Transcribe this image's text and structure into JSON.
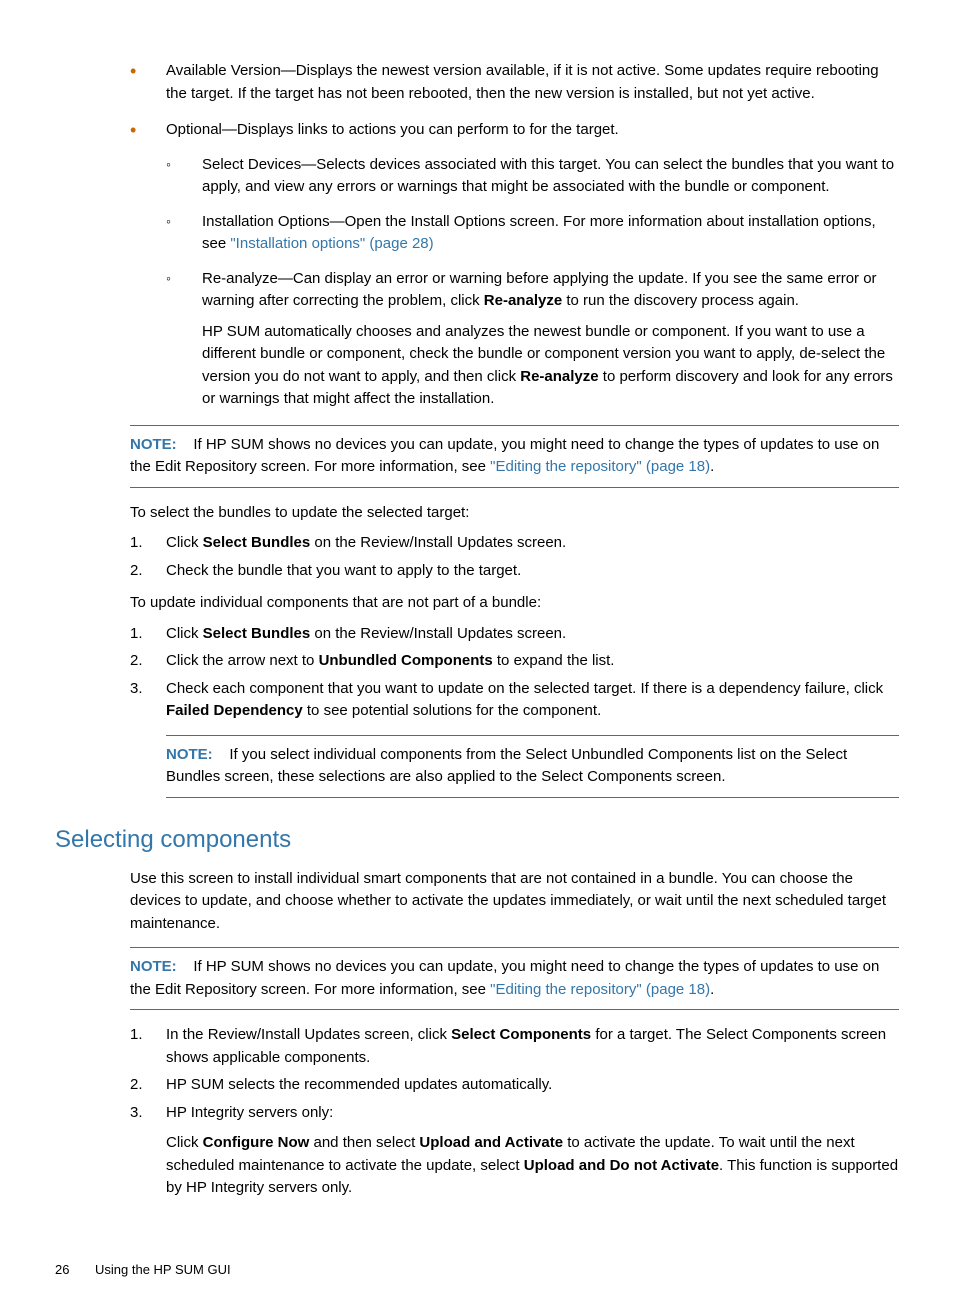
{
  "bullets": {
    "available_version": "Available Version—Displays the newest version available, if it is not active. Some updates require rebooting the target. If the target has not been rebooted, then the new version is installed, but not yet active.",
    "optional": "Optional—Displays links to actions you can perform to for the target.",
    "select_devices": "Select Devices—Selects devices associated with this target. You can select the bundles that you want to apply, and view any errors or warnings that might be associated with the bundle or component.",
    "install_options_pre": "Installation Options—Open the Install Options screen. For more information about installation options, see ",
    "install_options_link": "\"Installation options\" (page 28)",
    "reanalyze_pre": "Re-analyze—Can display an error or warning before applying the update. If you see the same error or warning after correcting the problem, click ",
    "reanalyze_bold": "Re-analyze",
    "reanalyze_post": " to run the discovery process again.",
    "hpsum_pre": "HP SUM automatically chooses and analyzes the newest bundle or component. If you want to use a different bundle or component, check the bundle or component version you want to apply, de-select the version you do not want to apply, and then click ",
    "hpsum_bold": "Re-analyze",
    "hpsum_post": " to perform discovery and look for any errors or warnings that might affect the installation."
  },
  "note1": {
    "label": "NOTE:",
    "text_pre": "If HP SUM shows no devices you can update, you might need to change the types of updates to use on the Edit Repository screen. For more information, see ",
    "link": "\"Editing the repository\" (page 18)",
    "text_post": "."
  },
  "para1": "To select the bundles to update the selected target:",
  "list1": {
    "i1_num": "1.",
    "i1_pre": "Click ",
    "i1_bold": "Select Bundles",
    "i1_post": " on the Review/Install Updates screen.",
    "i2_num": "2.",
    "i2": "Check the bundle that you want to apply to the target."
  },
  "para2": "To update individual components that are not part of a bundle:",
  "list2": {
    "i1_num": "1.",
    "i1_pre": "Click ",
    "i1_bold": "Select Bundles",
    "i1_post": " on the Review/Install Updates screen.",
    "i2_num": "2.",
    "i2_pre": "Click the arrow next to ",
    "i2_bold": "Unbundled Components",
    "i2_post": " to expand the list.",
    "i3_num": "3.",
    "i3_pre": "Check each component that you want to update on the selected target. If there is a dependency failure, click ",
    "i3_bold": "Failed Dependency",
    "i3_post": " to see potential solutions for the component."
  },
  "note2": {
    "label": "NOTE:",
    "text": "If you select individual components from the Select Unbundled Components list on the Select Bundles screen, these selections are also applied to the Select Components screen."
  },
  "heading": "Selecting components",
  "body1": "Use this screen to install individual smart components that are not contained in a bundle. You can choose the devices to update, and choose whether to activate the updates immediately, or wait until the next scheduled target maintenance.",
  "note3": {
    "label": "NOTE:",
    "text_pre": "If HP SUM shows no devices you can update, you might need to change the types of updates to use on the Edit Repository screen. For more information, see ",
    "link": "\"Editing the repository\" (page 18)",
    "text_post": "."
  },
  "list3": {
    "i1_num": "1.",
    "i1_pre": "In the Review/Install Updates screen, click ",
    "i1_bold": "Select Components",
    "i1_post": " for a target. The Select Components screen shows applicable components.",
    "i2_num": "2.",
    "i2": "HP SUM selects the recommended updates automatically.",
    "i3_num": "3.",
    "i3": "HP Integrity servers only:",
    "i3_sub_pre": "Click ",
    "i3_sub_b1": "Configure Now",
    "i3_sub_mid1": " and then select ",
    "i3_sub_b2": "Upload and Activate",
    "i3_sub_mid2": " to activate the update. To wait until the next scheduled maintenance to activate the update, select ",
    "i3_sub_b3": "Upload and Do not Activate",
    "i3_sub_post": ". This function is supported by HP Integrity servers only."
  },
  "footer": {
    "page": "26",
    "chapter": "Using the HP SUM GUI"
  }
}
